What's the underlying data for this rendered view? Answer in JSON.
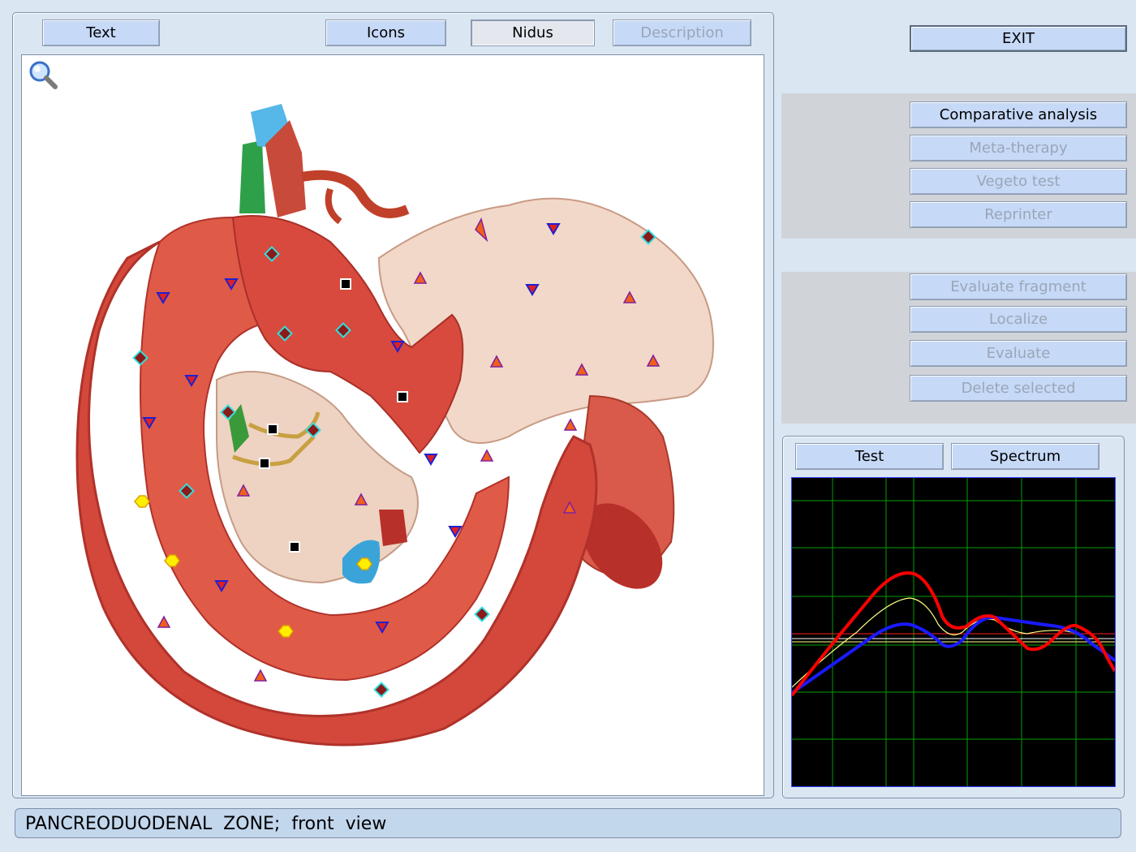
{
  "tabs": {
    "text": "Text",
    "icons": "Icons",
    "nidus": "Nidus",
    "description": "Description"
  },
  "exit_label": "EXIT",
  "analysis_buttons": [
    "Comparative analysis",
    "Meta-therapy",
    "Vegeto test",
    "Reprinter"
  ],
  "fragment_buttons": [
    "Evaluate fragment",
    "Localize",
    "Evaluate",
    "Delete selected"
  ],
  "graph_tabs": {
    "test": "Test",
    "spectrum": "Spectrum"
  },
  "status_text": "PANCREODUODENAL  ZONE;  front  view",
  "icons": {
    "zoom": "magnifier-icon"
  },
  "colors": {
    "button_bg": "#c6d9f7",
    "graph_red": "#ff0000",
    "graph_blue": "#1a1aff",
    "graph_yellow": "#ffff80",
    "grid": "#00aa00"
  }
}
